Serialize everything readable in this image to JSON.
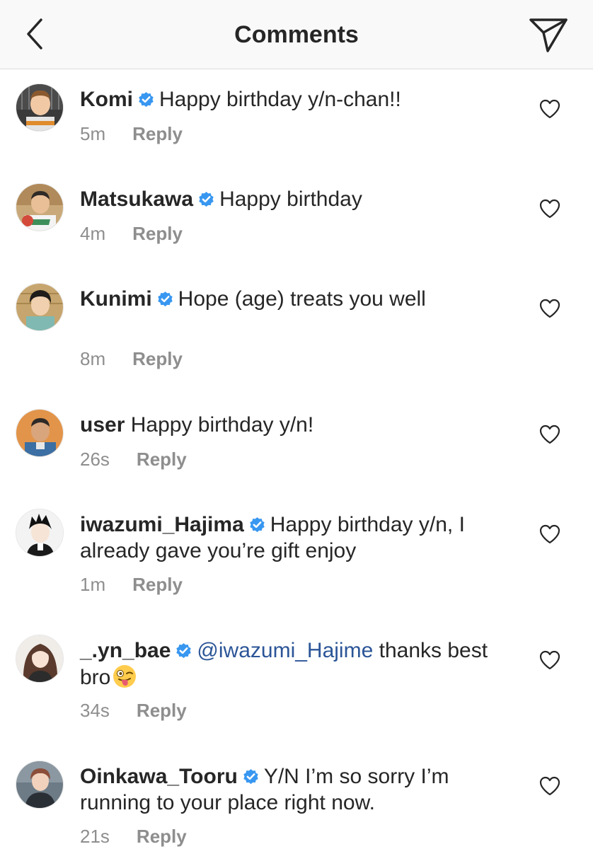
{
  "header": {
    "title": "Comments",
    "back_icon": "chevron-left-icon",
    "send_icon": "paper-plane-icon"
  },
  "colors": {
    "verified": "#3897f0",
    "mention": "#2b5597",
    "meta": "#8e8e8e",
    "text": "#262626"
  },
  "comments": [
    {
      "username": "Komi",
      "verified": true,
      "mention": "",
      "text": "Happy birthday y/n-chan!!",
      "time": "5m",
      "reply_label": "Reply"
    },
    {
      "username": "Matsukawa",
      "verified": true,
      "mention": "",
      "text": "Happy birthday",
      "time": "4m",
      "reply_label": "Reply"
    },
    {
      "username": "Kunimi",
      "verified": true,
      "mention": "",
      "text": "Hope (age) treats you well",
      "time": "8m",
      "reply_label": "Reply"
    },
    {
      "username": "user",
      "verified": false,
      "mention": "",
      "text": "Happy birthday y/n!",
      "time": "26s",
      "reply_label": "Reply"
    },
    {
      "username": "iwazumi_Hajima",
      "verified": true,
      "mention": "",
      "text": "Happy birthday y/n, I already gave you’re gift enjoy",
      "time": "1m",
      "reply_label": "Reply"
    },
    {
      "username": "_.yn_bae",
      "verified": true,
      "mention": "@iwazumi_Hajime",
      "text": "thanks best bro",
      "emoji": "winking-face-with-tongue-emoji",
      "time": "34s",
      "reply_label": "Reply"
    },
    {
      "username": "Oinkawa_Tooru",
      "verified": true,
      "mention": "",
      "text": "Y/N I’m so sorry I’m running to your place right now.",
      "time": "21s",
      "reply_label": "Reply"
    }
  ]
}
